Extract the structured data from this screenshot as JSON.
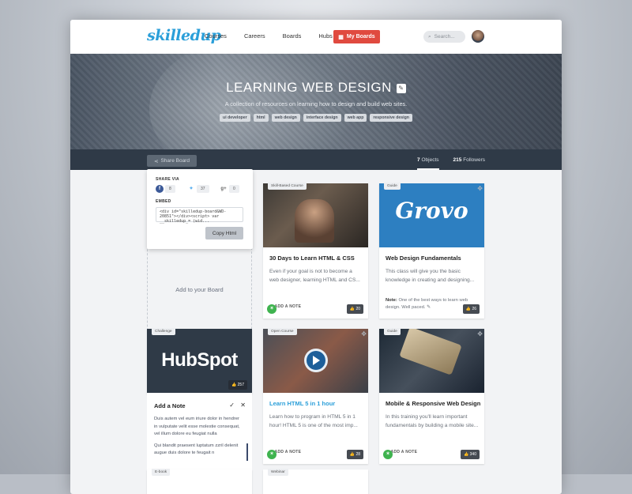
{
  "topbar": {
    "logo": "skilledup",
    "nav": [
      "Courses",
      "Careers",
      "Boards",
      "Hubs"
    ],
    "myboards": "My Boards",
    "search_placeholder": "Search..."
  },
  "hero": {
    "title": "LEARNING WEB DESIGN",
    "description": "A collection of resources on learning how to design and build web sites.",
    "tags": [
      "ui developer",
      "html",
      "web design",
      "interface design",
      "web app",
      "responsive design"
    ]
  },
  "subbar": {
    "share": "Share Board",
    "objects_count": "7",
    "objects_label": "Objects",
    "followers_count": "215",
    "followers_label": "Followers"
  },
  "share_popup": {
    "share_via": "SHARE VIA",
    "facebook_count": "8",
    "twitter_count": "37",
    "google_count": "0",
    "embed_label": "EMBED",
    "embed_code": "<div id=\"skilledup-board&WD-20851\"></div><script> var __skilledup_= (wid...",
    "copy_button": "Copy Html"
  },
  "add_board": "Add to your Board",
  "cards": [
    {
      "label": "Skill-Based Course",
      "likes": "20",
      "title": "30 Days to Learn HTML & CSS",
      "desc": "Even if your goal is not to become a web designer, learning HTML and CS...",
      "addnote": "ADD A NOTE"
    },
    {
      "label": "Guide",
      "likes": "26",
      "title": "Web Design Fundamentals",
      "desc": "This class will give you the basic knowledge in creating and designing...",
      "note_label": "Note:",
      "note": "One of the best ways to learn web design. Well paced.",
      "logo": "Grovo"
    },
    {
      "label": "Challenge",
      "likes": "257",
      "logo": "HubSpot"
    },
    {
      "label": "Open Course",
      "likes": "28",
      "title": "Learn HTML 5 in 1 hour",
      "desc": "Learn how to program in HTML 5 in 1 hour! HTML 5 is one of the most imp...",
      "addnote": "ADD A NOTE"
    },
    {
      "label": "Guide",
      "likes": "340",
      "title": "Mobile & Responsive Web Design",
      "desc": "In this training you'll learn important fundamentals by building a mobile site...",
      "addnote": "ADD A NOTE"
    }
  ],
  "note_panel": {
    "title": "Add a Note",
    "text1": "Duis autem vel eum iriure dolor in hendrer in vulputate velit esse molestie consequat, vel illum dolore eu feugiat nulla",
    "text2": "Qui blandit praesent luptatum zzril delenit augue duis dolore te feugait n"
  },
  "bottom_labels": [
    "E-book",
    "Webinar"
  ],
  "colors": {
    "accent": "#e04a3f",
    "brand": "#2b9fd9",
    "dark": "#2f3a47"
  }
}
